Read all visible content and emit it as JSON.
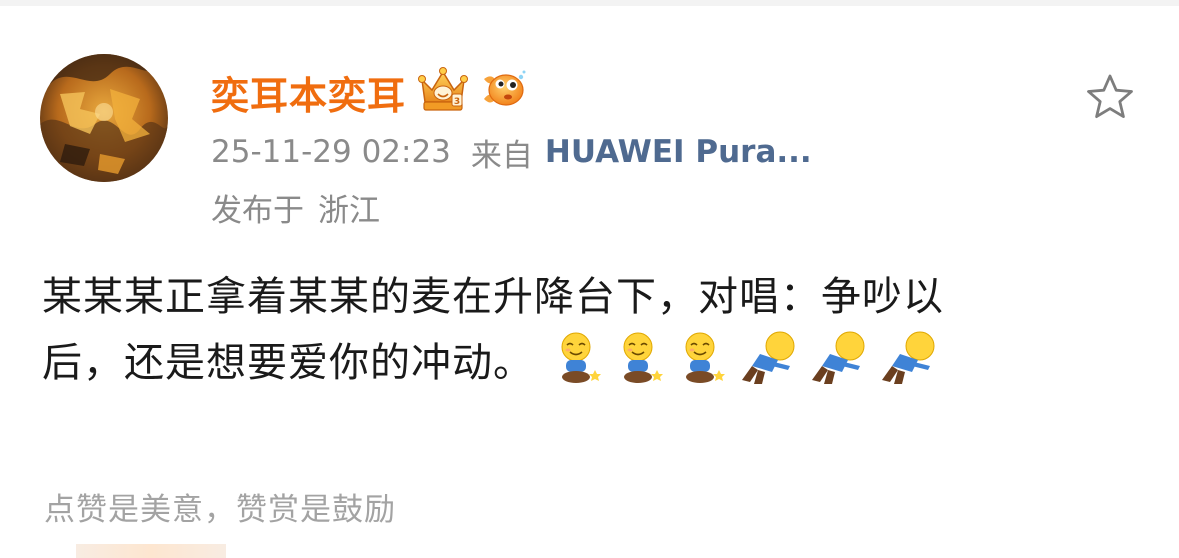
{
  "post": {
    "username": "奕耳本奕耳",
    "timestamp": "25-11-29 02:23",
    "source_prefix": "来自",
    "device": "HUAWEI Pura...",
    "location_prefix": "发布于",
    "location": "浙江",
    "text_line1": "某某某正拿着某某的麦在升降台下，对唱：争吵以",
    "text_line2": "后，还是想要爱你的冲动。",
    "emojis": [
      "sitting-smile-emoji",
      "sitting-smile-emoji",
      "sitting-smile-emoji",
      "kowtow-emoji",
      "kowtow-emoji",
      "kowtow-emoji"
    ]
  },
  "actions": {
    "favorite_icon": "star-outline-icon",
    "like_hint": "点赞是美意，赞赏是鼓励"
  },
  "badges": [
    "crown-vip-badge",
    "goldfish-badge"
  ],
  "colors": {
    "username": "#f06d0f",
    "device_link": "#4f6a90",
    "meta_text": "#8a8a8a",
    "body_text": "#1a1a1a",
    "hint_text": "#a3a3a3"
  }
}
